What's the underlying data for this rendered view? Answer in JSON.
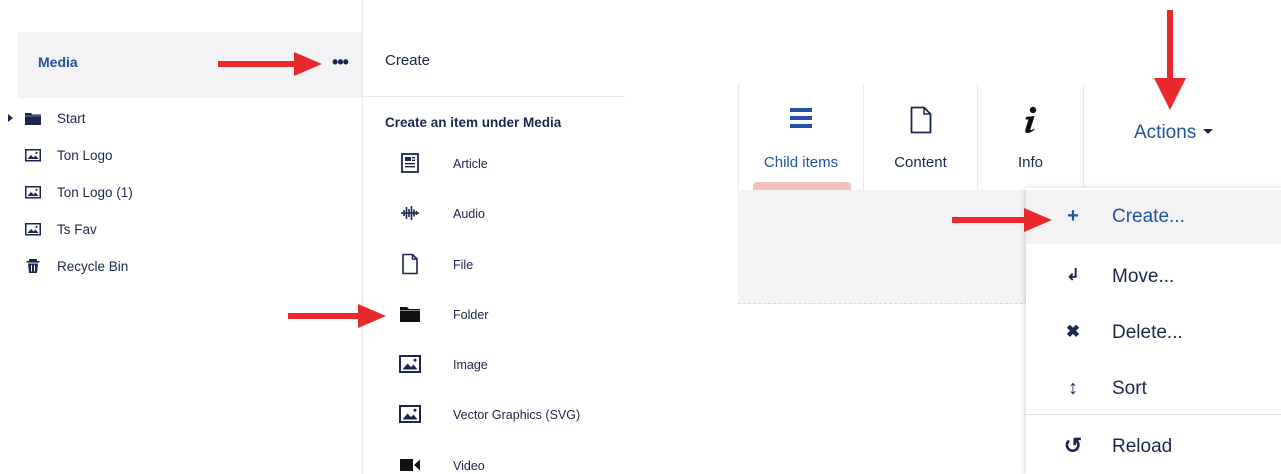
{
  "tree": {
    "title": "Media",
    "more_label": "•••",
    "items": [
      {
        "label": "Start",
        "icon": "folder-icon"
      },
      {
        "label": "Ton Logo",
        "icon": "image-icon"
      },
      {
        "label": "Ton Logo (1)",
        "icon": "image-icon"
      },
      {
        "label": "Ts Fav",
        "icon": "image-icon"
      },
      {
        "label": "Recycle Bin",
        "icon": "trash-icon"
      }
    ]
  },
  "create": {
    "title": "Create",
    "subtitle": "Create an item under Media",
    "items": [
      {
        "label": "Article",
        "icon": "article-icon"
      },
      {
        "label": "Audio",
        "icon": "audio-icon"
      },
      {
        "label": "File",
        "icon": "file-icon"
      },
      {
        "label": "Folder",
        "icon": "folder-icon"
      },
      {
        "label": "Image",
        "icon": "image-icon"
      },
      {
        "label": "Vector Graphics (SVG)",
        "icon": "image-icon"
      },
      {
        "label": "Video",
        "icon": "video-icon"
      }
    ]
  },
  "editor": {
    "tabs": [
      {
        "label": "Child items",
        "icon": "list-icon",
        "active": true
      },
      {
        "label": "Content",
        "icon": "document-icon"
      },
      {
        "label": "Info",
        "icon": "info-icon"
      }
    ],
    "actions_label": "Actions"
  },
  "actions_menu": {
    "items": [
      {
        "label": "Create...",
        "icon": "plus-icon",
        "symbol": "+"
      },
      {
        "label": "Move...",
        "icon": "move-icon",
        "symbol": "↲"
      },
      {
        "label": "Delete...",
        "icon": "delete-icon",
        "symbol": "✖"
      },
      {
        "label": "Sort",
        "icon": "sort-icon",
        "symbol": "↕"
      },
      {
        "label": "Reload",
        "icon": "reload-icon",
        "symbol": "↺"
      }
    ]
  },
  "colors": {
    "brand_blue": "#2152a3",
    "text_dark": "#1b264f",
    "annotation_red": "#e8282b",
    "active_underline": "#f5c1bc"
  }
}
